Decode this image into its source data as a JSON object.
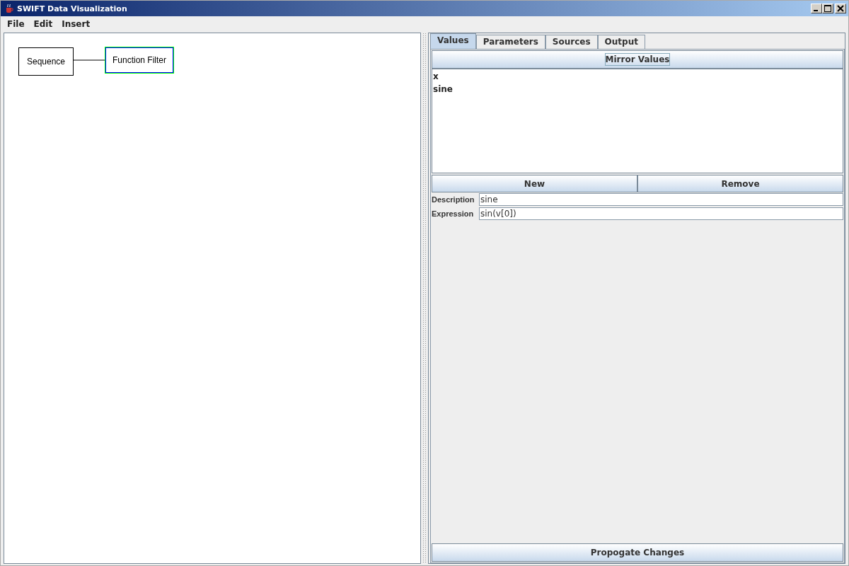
{
  "window": {
    "title": "SWIFT Data Visualization"
  },
  "menu": [
    {
      "label": "File"
    },
    {
      "label": "Edit"
    },
    {
      "label": "Insert"
    }
  ],
  "diagram": {
    "nodes": [
      {
        "label": "Sequence",
        "selected": false
      },
      {
        "label": "Function Filter",
        "selected": true
      }
    ]
  },
  "tabs": [
    {
      "label": "Values",
      "selected": true
    },
    {
      "label": "Parameters",
      "selected": false
    },
    {
      "label": "Sources",
      "selected": false
    },
    {
      "label": "Output",
      "selected": false
    }
  ],
  "mirror_button": "Mirror Values",
  "values_list": [
    {
      "label": "x"
    },
    {
      "label": "sine"
    }
  ],
  "buttons": [
    "New",
    "Remove"
  ],
  "fields": [
    {
      "label": "Description",
      "value": "sine"
    },
    {
      "label": "Expression",
      "value": "sin(v[0])"
    }
  ],
  "propagate_button": "Propogate Changes"
}
